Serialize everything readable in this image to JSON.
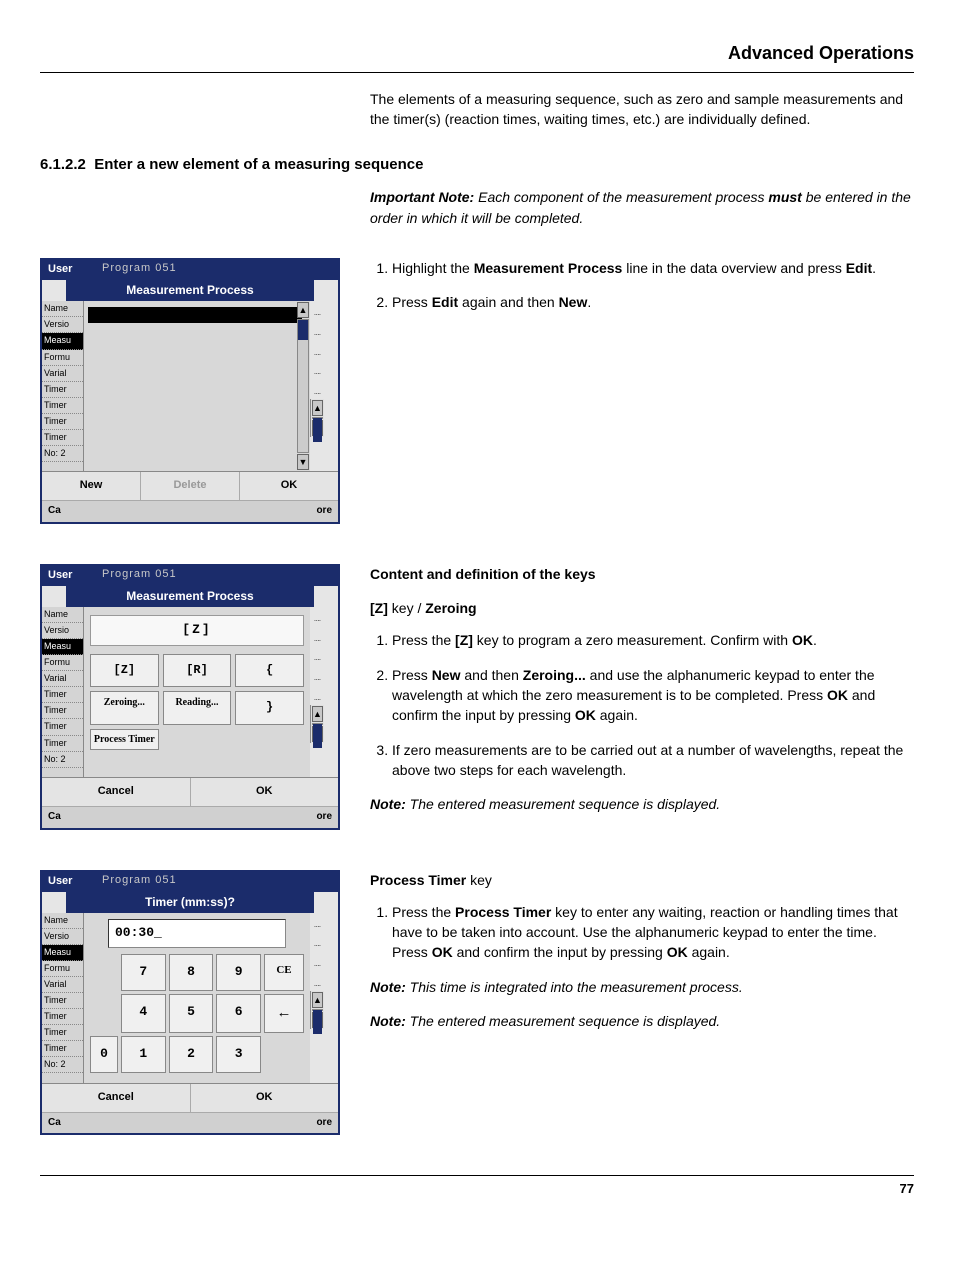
{
  "header": {
    "title": "Advanced Operations"
  },
  "intro": "The elements of a measuring sequence, such as zero and sample measurements and the timer(s) (reaction times, waiting times, etc.) are individually defined.",
  "section": {
    "number": "6.1.2.2",
    "title": "Enter a new element of a measuring sequence"
  },
  "important_note": {
    "lead": "Important Note:",
    "body1": " Each component of the measurement process ",
    "must": "must",
    "body2": " be entered in the order in which it will be completed."
  },
  "device_common": {
    "user": "User",
    "prog_frag": "Program    051",
    "side_items": [
      "Name",
      "Versio",
      "Measu",
      "Formu",
      "Varial",
      "Timer",
      "Timer",
      "Timer",
      "Timer",
      "No: 2"
    ],
    "side_sel_index": 2,
    "footer_left": "Ca",
    "footer_right": "ore"
  },
  "device1": {
    "dialog_title": "Measurement Process",
    "btn_new": "New",
    "btn_delete": "Delete",
    "btn_ok": "OK"
  },
  "device2": {
    "dialog_title": "Measurement Process",
    "field": "[Z]",
    "keys_row1": [
      "[Z]",
      "[R]",
      "{"
    ],
    "keys_row2": [
      "Zeroing...",
      "Reading...",
      "}"
    ],
    "keys_row3_left": "Process Timer",
    "btn_cancel": "Cancel",
    "btn_ok": "OK"
  },
  "device3": {
    "dialog_title": "Timer (mm:ss)?",
    "value": "00:30_",
    "keys": {
      "r1": [
        "7",
        "8",
        "9"
      ],
      "r1_ce": "CE",
      "r2": [
        "4",
        "5",
        "6"
      ],
      "r2_back": "←",
      "r3_zero": "0",
      "r3": [
        "1",
        "2",
        "3"
      ]
    },
    "btn_cancel": "Cancel",
    "btn_ok": "OK"
  },
  "steps_block1": {
    "s1_a": "Highlight the ",
    "s1_b": "Measurement Process",
    "s1_c": " line in the data overview and press ",
    "s1_d": "Edit",
    "s1_e": ".",
    "s2_a": "Press ",
    "s2_b": "Edit",
    "s2_c": " again and then ",
    "s2_d": "New",
    "s2_e": "."
  },
  "keys_section": {
    "heading": "Content and definition of the keys",
    "z_head_a": "[Z]",
    "z_head_b": " key / ",
    "z_head_c": "Zeroing",
    "z1_a": "Press the ",
    "z1_b": "[Z]",
    "z1_c": " key to program a zero measurement. Confirm with ",
    "z1_d": "OK",
    "z1_e": ".",
    "z2_a": "Press ",
    "z2_b": "New",
    "z2_c": " and then ",
    "z2_d": "Zeroing...",
    "z2_e": " and use the alphanumeric keypad to enter the wavelength at which the zero measurement is to be completed. Press ",
    "z2_f": "OK",
    "z2_g": " and confirm the input by pressing ",
    "z2_h": "OK",
    "z2_i": " again.",
    "z3": "If zero measurements are to be carried out at a number of wavelengths, repeat the above two steps for each wavelength.",
    "z_note_lead": "Note:",
    "z_note_body": " The entered measurement sequence is displayed."
  },
  "timer_section": {
    "head_a": "Process Timer",
    "head_b": " key",
    "t1_a": "Press the ",
    "t1_b": "Process Timer",
    "t1_c": " key to enter any waiting, reaction or handling times that have to be taken into account. Use the alphanumeric keypad to enter the time. Press ",
    "t1_d": "OK",
    "t1_e": " and confirm the input by pressing ",
    "t1_f": "OK",
    "t1_g": " again.",
    "n1_lead": "Note:",
    "n1_body": " This time is integrated into the measurement process.",
    "n2_lead": "Note:",
    "n2_body": " The entered measurement sequence is displayed."
  },
  "page_number": "77"
}
